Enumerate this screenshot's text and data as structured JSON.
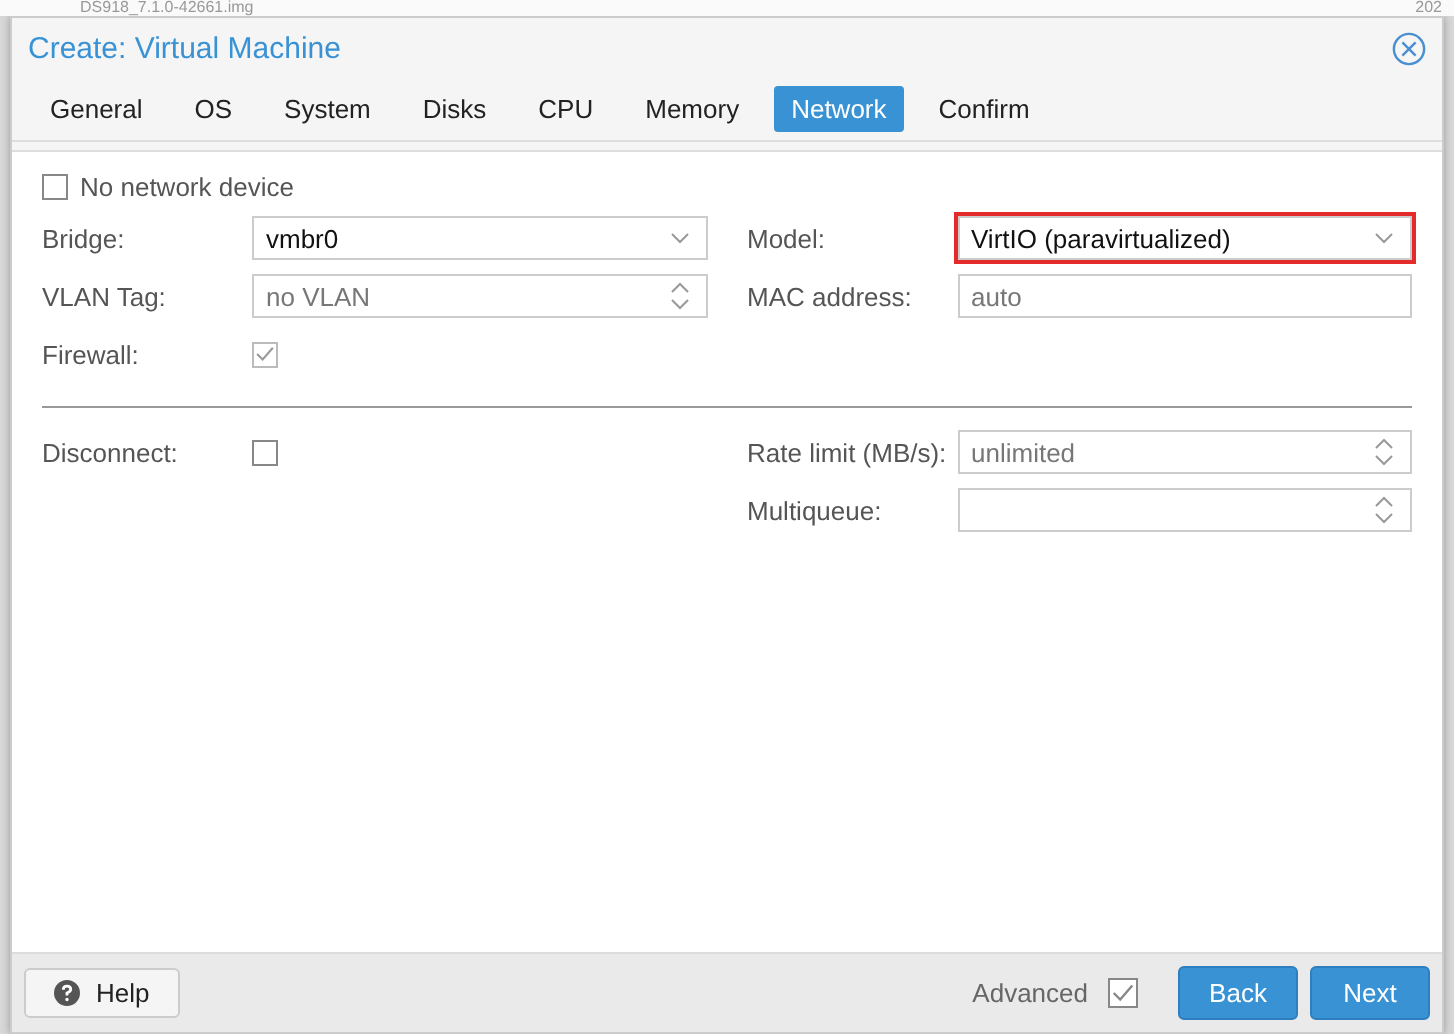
{
  "background": {
    "file_name": "DS918_7.1.0-42661.img",
    "column_text": "202"
  },
  "window": {
    "title": "Create: Virtual Machine"
  },
  "tabs": [
    {
      "label": "General",
      "selected": false
    },
    {
      "label": "OS",
      "selected": false
    },
    {
      "label": "System",
      "selected": false
    },
    {
      "label": "Disks",
      "selected": false
    },
    {
      "label": "CPU",
      "selected": false
    },
    {
      "label": "Memory",
      "selected": false
    },
    {
      "label": "Network",
      "selected": true
    },
    {
      "label": "Confirm",
      "selected": false
    }
  ],
  "no_network_device": {
    "label": "No network device",
    "checked": false
  },
  "left_fields": [
    {
      "label": "Bridge:",
      "kind": "combo",
      "value": "vmbr0"
    },
    {
      "label": "VLAN Tag:",
      "kind": "spinner",
      "placeholder": "no VLAN"
    },
    {
      "label": "Firewall:",
      "kind": "checkbox",
      "checked": true,
      "disabled": true
    }
  ],
  "right_fields": [
    {
      "label": "Model:",
      "kind": "combo",
      "value": "VirtIO (paravirtualized)",
      "highlighted": true
    },
    {
      "label": "MAC address:",
      "kind": "text",
      "placeholder": "auto"
    }
  ],
  "advanced_left": [
    {
      "label": "Disconnect:",
      "kind": "checkbox",
      "checked": false,
      "disabled": false
    }
  ],
  "advanced_right": [
    {
      "label": "Rate limit (MB/s):",
      "kind": "spinner",
      "placeholder": "unlimited"
    },
    {
      "label": "Multiqueue:",
      "kind": "spinner"
    }
  ],
  "footer": {
    "help": "Help",
    "advanced": {
      "label": "Advanced",
      "checked": true
    },
    "buttons": [
      "Back",
      "Next"
    ]
  }
}
